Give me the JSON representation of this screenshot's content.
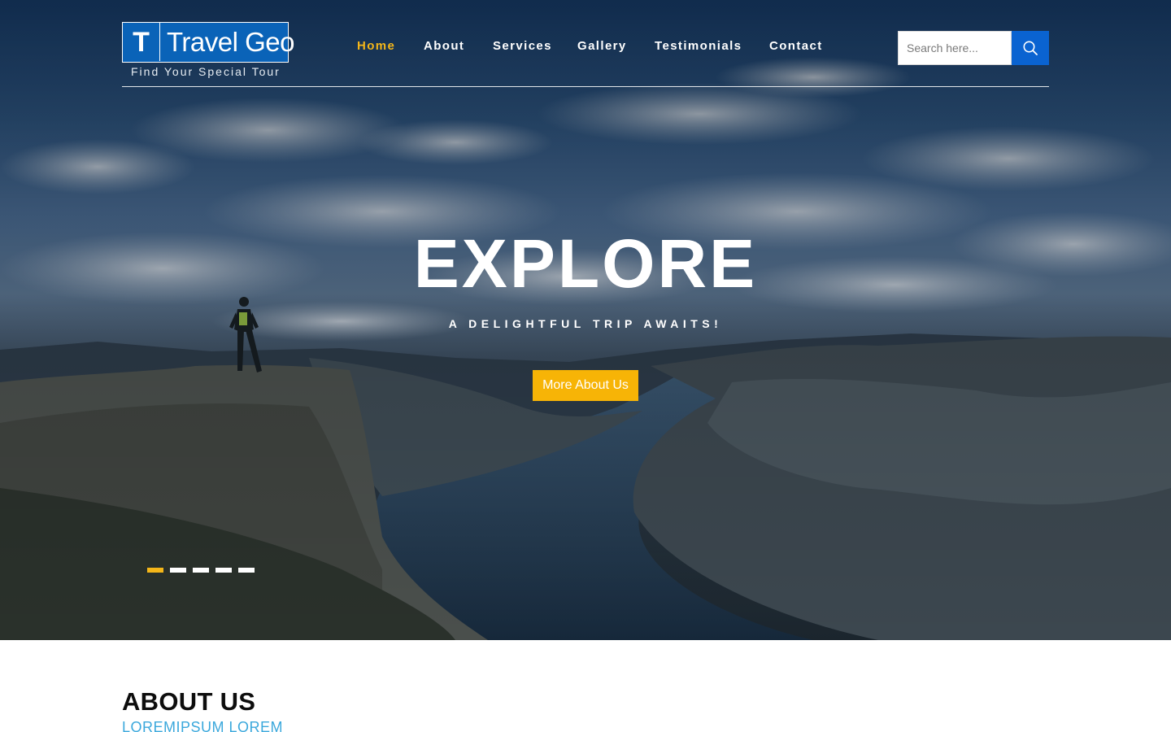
{
  "brand": {
    "logo_letter": "T",
    "name": "Travel Geo",
    "tagline": "Find Your Special Tour"
  },
  "nav": {
    "items": [
      {
        "label": "Home",
        "active": true
      },
      {
        "label": "About",
        "active": false
      },
      {
        "label": "Services",
        "active": false
      },
      {
        "label": "Gallery",
        "active": false
      },
      {
        "label": "Testimonials",
        "active": false
      },
      {
        "label": "Contact",
        "active": false
      }
    ]
  },
  "search": {
    "placeholder": "Search here...",
    "button_icon": "search-icon"
  },
  "hero": {
    "title": "EXPLORE",
    "subtitle": "A DELIGHTFUL TRIP AWAITS!",
    "cta_label": "More About Us",
    "slides_total": 5,
    "active_slide": 1
  },
  "about": {
    "title": "ABOUT US",
    "subtitle": "LOREMIPSUM LOREM"
  },
  "colors": {
    "accent": "#f4b619",
    "brand_blue": "#0a63b8",
    "search_blue": "#0a63d1",
    "cta": "#f7b406",
    "subtitle_blue": "#3ba8dc"
  }
}
